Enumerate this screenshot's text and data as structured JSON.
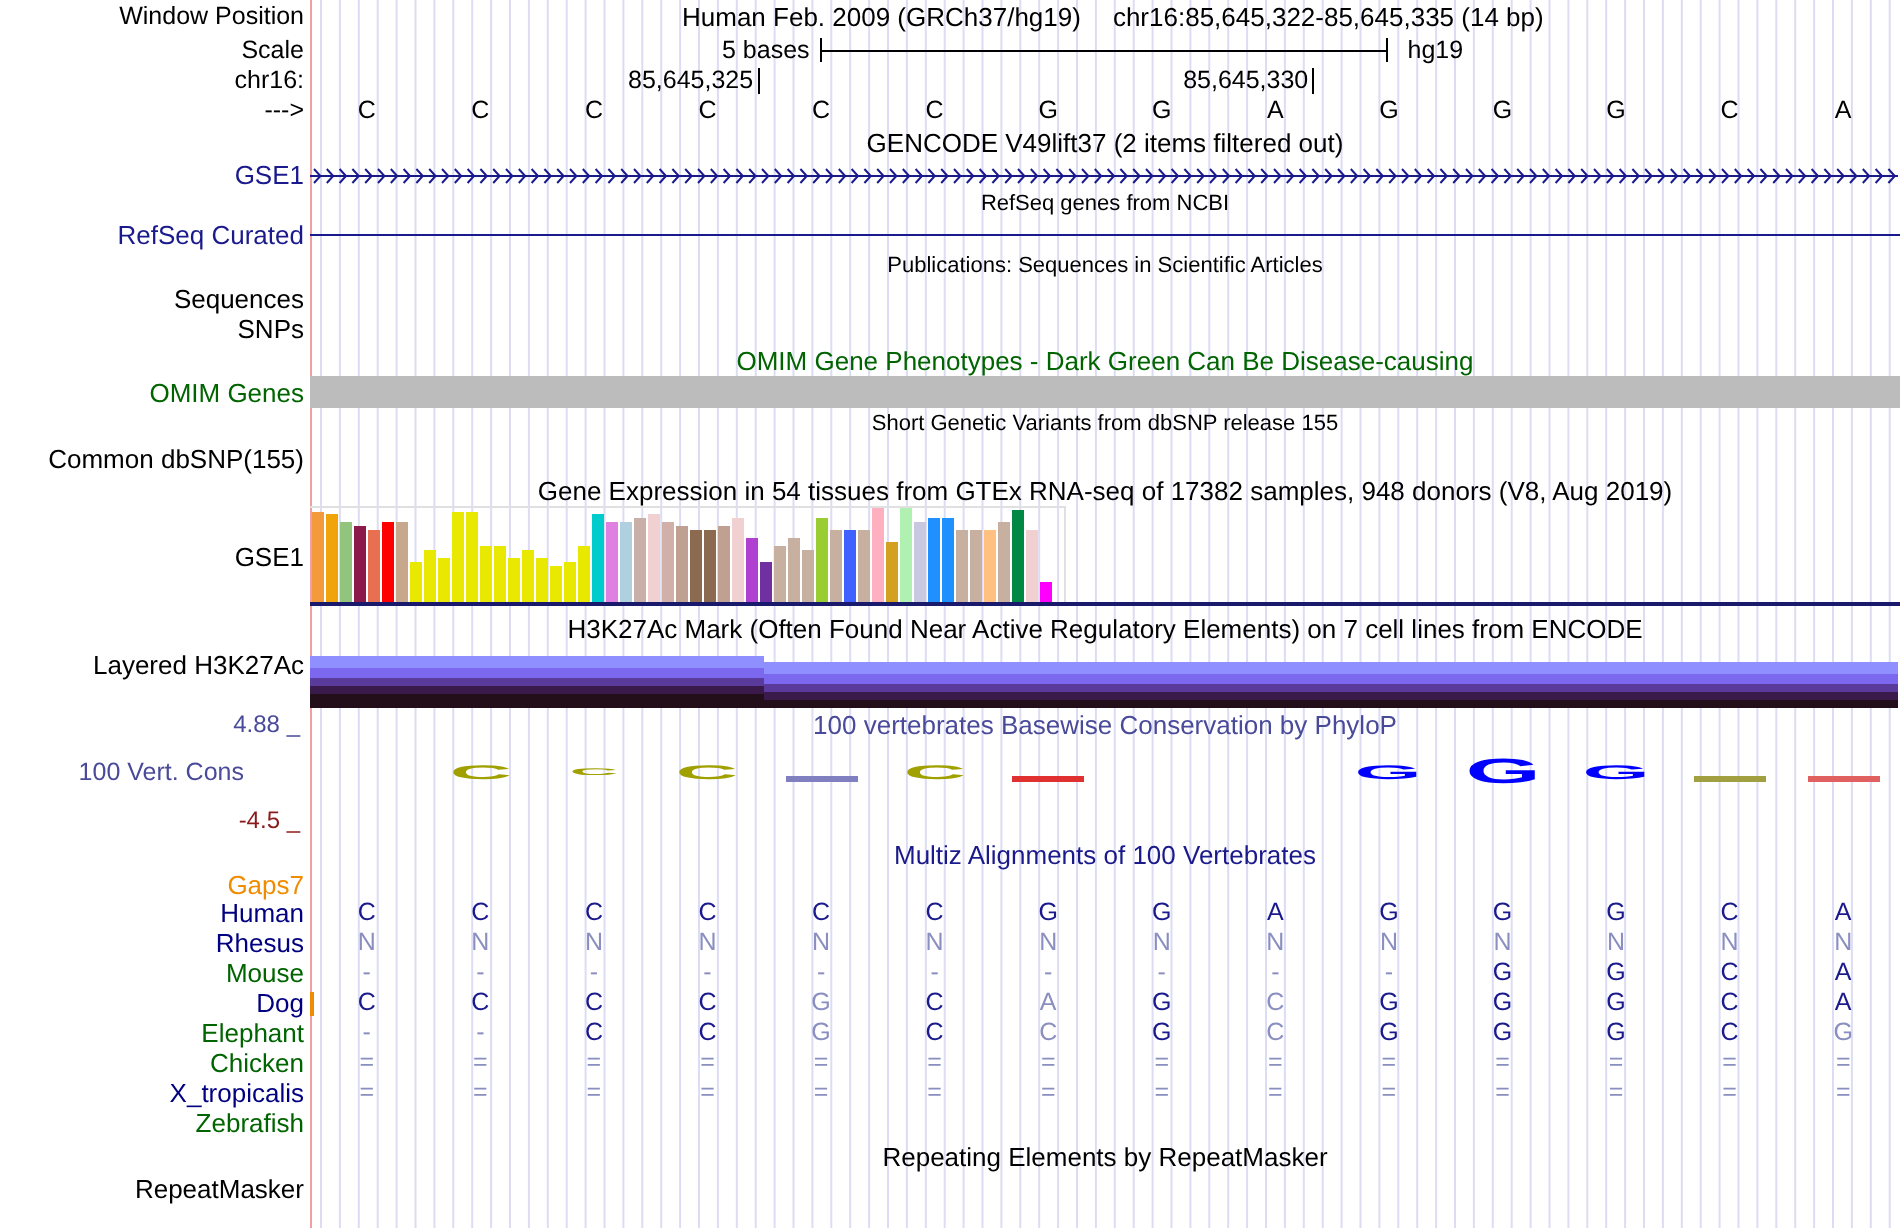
{
  "window_position": {
    "label": "Window Position",
    "assembly": "Human Feb. 2009 (GRCh37/hg19)",
    "range": "chr16:85,645,322-85,645,335 (14 bp)"
  },
  "scale": {
    "label": "Scale",
    "length": "5 bases",
    "assembly": "hg19"
  },
  "chromosome": {
    "label": "chr16:",
    "positions": [
      "85,645,325",
      "85,645,330"
    ]
  },
  "sequence": {
    "label": "--->",
    "bases": [
      "C",
      "C",
      "C",
      "C",
      "C",
      "C",
      "G",
      "G",
      "A",
      "G",
      "G",
      "G",
      "C",
      "A"
    ]
  },
  "tracks": [
    {
      "kind": "strand",
      "title": "GENCODE V49lift37 (2 items filtered out)",
      "labels": [
        "GSE1"
      ]
    },
    {
      "kind": "line",
      "title": "RefSeq genes from NCBI",
      "labels": [
        "RefSeq Curated"
      ]
    },
    {
      "kind": "note",
      "title": "Publications: Sequences in Scientific Articles",
      "labels": [
        "Sequences",
        "SNPs"
      ]
    },
    {
      "kind": "bar",
      "title": "OMIM Gene Phenotypes - Dark Green Can Be Disease-causing",
      "labels": [
        "OMIM Genes"
      ]
    },
    {
      "kind": "note",
      "title": "Short Genetic Variants from dbSNP release 155",
      "labels": [
        "Common dbSNP(155)"
      ]
    },
    {
      "kind": "expression",
      "title": "Gene Expression in 54 tissues from GTEx RNA-seq of 17382 samples, 948 donors (V8, Aug 2019)",
      "labels": [
        "GSE1"
      ]
    },
    {
      "kind": "layered",
      "title": "H3K27Ac Mark (Often Found Near Active Regulatory Elements) on 7 cell lines from ENCODE",
      "labels": [
        "Layered H3K27Ac"
      ]
    },
    {
      "kind": "conservation",
      "title": "100 vertebrates Basewise Conservation by PhyloP",
      "labels": [
        "100 Vert. Cons"
      ],
      "max": "4.88 _",
      "min": "-4.5 _",
      "letters": [
        {
          "kind": "none"
        },
        {
          "kind": "letter",
          "base": "C",
          "color": "#a0a000"
        },
        {
          "kind": "small",
          "base": "C",
          "color": "#a0a000"
        },
        {
          "kind": "letter",
          "base": "C",
          "color": "#a0a000"
        },
        {
          "kind": "mark",
          "color": "#8080c0"
        },
        {
          "kind": "letter",
          "base": "C",
          "color": "#a0a000"
        },
        {
          "kind": "mark",
          "color": "#e03030"
        },
        {
          "kind": "none"
        },
        {
          "kind": "none"
        },
        {
          "kind": "letter",
          "base": "G",
          "color": "#0000ff"
        },
        {
          "kind": "large",
          "base": "G",
          "color": "#0000ff"
        },
        {
          "kind": "letter",
          "base": "G",
          "color": "#0000ff"
        },
        {
          "kind": "mark",
          "color": "#a0a040"
        },
        {
          "kind": "mark",
          "color": "#e06060"
        }
      ]
    },
    {
      "kind": "alignment",
      "title": "Multiz Alignments of 100 Vertebrates",
      "gaps_label": "Gaps7",
      "species": [
        {
          "name": "Human",
          "color": "#000080",
          "marked": false,
          "bases": [
            "C",
            "C",
            "C",
            "C",
            "C",
            "C",
            "G",
            "G",
            "A",
            "G",
            "G",
            "G",
            "C",
            "A"
          ],
          "faded": [
            false,
            false,
            false,
            false,
            false,
            false,
            false,
            false,
            false,
            false,
            false,
            false,
            false,
            false
          ]
        },
        {
          "name": "Rhesus",
          "color": "#000080",
          "marked": false,
          "bases": [
            "N",
            "N",
            "N",
            "N",
            "N",
            "N",
            "N",
            "N",
            "N",
            "N",
            "N",
            "N",
            "N",
            "N"
          ],
          "faded": [
            true,
            true,
            true,
            true,
            true,
            true,
            true,
            true,
            true,
            true,
            true,
            true,
            true,
            true
          ]
        },
        {
          "name": "Mouse",
          "color": "#006400",
          "marked": false,
          "bases": [
            "-",
            "-",
            "-",
            "-",
            "-",
            "-",
            "-",
            "-",
            "-",
            "-",
            "G",
            "G",
            "C",
            "A"
          ],
          "faded": [
            true,
            true,
            true,
            true,
            true,
            true,
            true,
            true,
            true,
            true,
            false,
            false,
            false,
            false
          ]
        },
        {
          "name": "Dog",
          "color": "#000080",
          "marked": true,
          "bases": [
            "C",
            "C",
            "C",
            "C",
            "G",
            "C",
            "A",
            "G",
            "C",
            "G",
            "G",
            "G",
            "C",
            "A"
          ],
          "faded": [
            false,
            false,
            false,
            false,
            true,
            false,
            true,
            false,
            true,
            false,
            false,
            false,
            false,
            false
          ]
        },
        {
          "name": "Elephant",
          "color": "#006400",
          "marked": false,
          "bases": [
            "-",
            "-",
            "C",
            "C",
            "G",
            "C",
            "C",
            "G",
            "C",
            "G",
            "G",
            "G",
            "C",
            "G"
          ],
          "faded": [
            true,
            true,
            false,
            false,
            true,
            false,
            true,
            false,
            true,
            false,
            false,
            false,
            false,
            true
          ]
        },
        {
          "name": "Chicken",
          "color": "#006400",
          "marked": false,
          "bases": [
            "=",
            "=",
            "=",
            "=",
            "=",
            "=",
            "=",
            "=",
            "=",
            "=",
            "=",
            "=",
            "=",
            "="
          ],
          "faded": [
            true,
            true,
            true,
            true,
            true,
            true,
            true,
            true,
            true,
            true,
            true,
            true,
            true,
            true
          ]
        },
        {
          "name": "X_tropicalis",
          "color": "#000080",
          "marked": false,
          "bases": [
            "=",
            "=",
            "=",
            "=",
            "=",
            "=",
            "=",
            "=",
            "=",
            "=",
            "=",
            "=",
            "=",
            "="
          ],
          "faded": [
            true,
            true,
            true,
            true,
            true,
            true,
            true,
            true,
            true,
            true,
            true,
            true,
            true,
            true
          ]
        },
        {
          "name": "Zebrafish",
          "color": "#006400",
          "marked": false
        }
      ]
    },
    {
      "kind": "empty",
      "title": "Repeating Elements by RepeatMasker",
      "labels": [
        "RepeatMasker"
      ]
    }
  ]
}
